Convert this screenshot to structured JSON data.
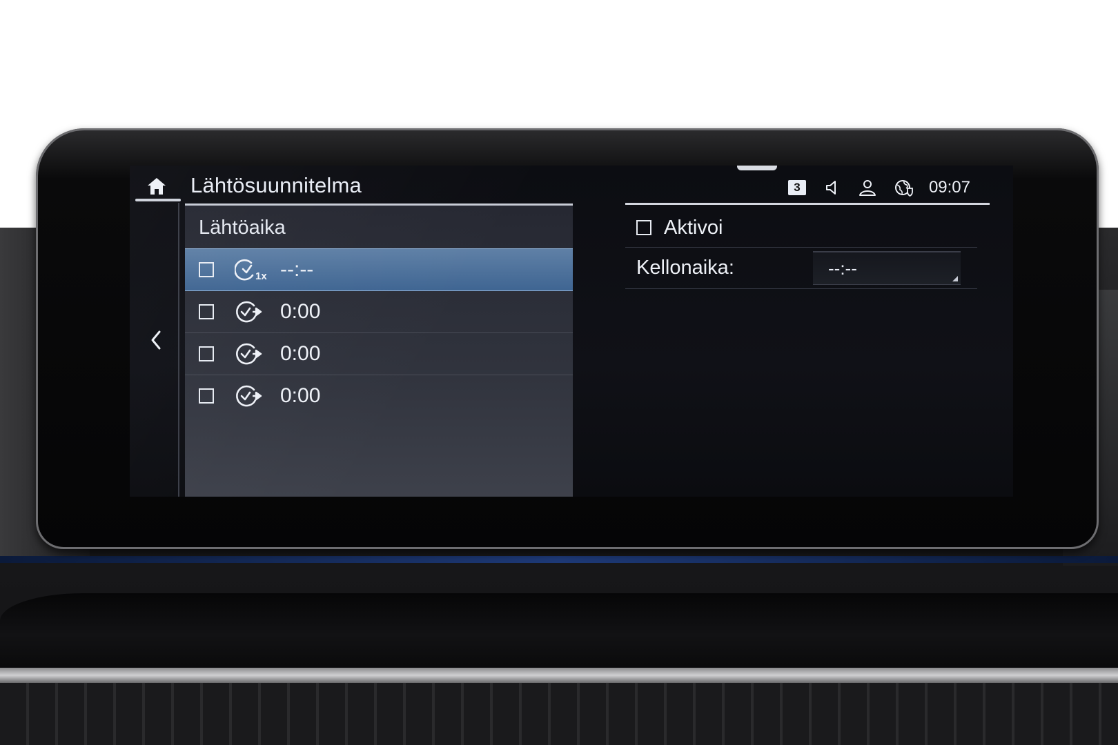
{
  "header": {
    "title": "Lähtösuunnitelma",
    "status": {
      "badge": "3",
      "time": "09:07"
    }
  },
  "list": {
    "heading": "Lähtöaika",
    "items": [
      {
        "time": "--:--",
        "icon": "one-time-timer-icon",
        "checked": false,
        "selected": true
      },
      {
        "time": "0:00",
        "icon": "recurring-timer-icon",
        "checked": false,
        "selected": false
      },
      {
        "time": "0:00",
        "icon": "recurring-timer-icon",
        "checked": false,
        "selected": false
      },
      {
        "time": "0:00",
        "icon": "recurring-timer-icon",
        "checked": false,
        "selected": false
      }
    ]
  },
  "detail": {
    "activate_label": "Aktivoi",
    "time_label": "Kellonaika:",
    "time_value": "--:--"
  },
  "colors": {
    "selection": "#4f729c",
    "text": "#eef1f7",
    "panel": "#30333d"
  }
}
